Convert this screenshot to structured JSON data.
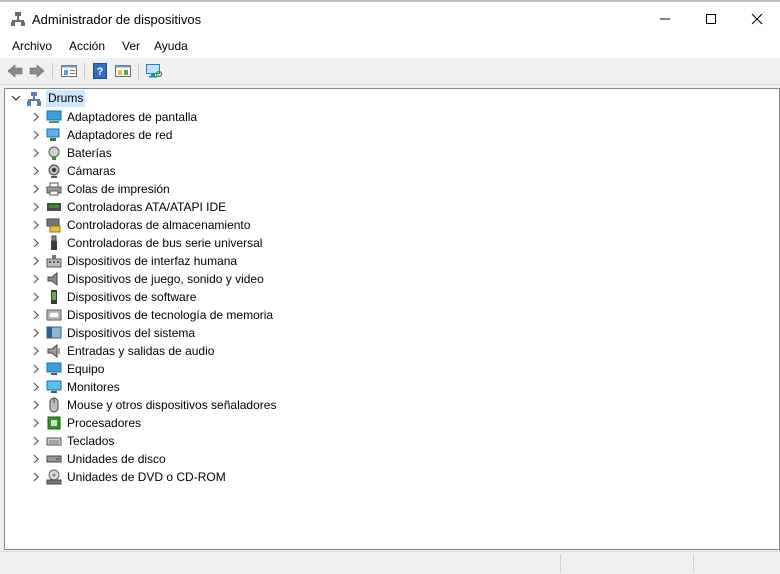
{
  "window": {
    "title": "Administrador de dispositivos"
  },
  "menu": [
    "Archivo",
    "Acción",
    "Ver",
    "Ayuda"
  ],
  "toolbar": [
    "back-icon",
    "forward-icon",
    "properties-icon",
    "help-icon",
    "details-icon",
    "scan-hardware-icon"
  ],
  "tree": {
    "root": {
      "label": "Drums",
      "expanded": true
    },
    "items": [
      {
        "label": "Adaptadores de pantalla",
        "icon": "display-adapter-icon"
      },
      {
        "label": "Adaptadores de red",
        "icon": "network-adapter-icon"
      },
      {
        "label": "Baterías",
        "icon": "battery-icon"
      },
      {
        "label": "Cámaras",
        "icon": "camera-icon"
      },
      {
        "label": "Colas de impresión",
        "icon": "printer-icon"
      },
      {
        "label": "Controladoras ATA/ATAPI IDE",
        "icon": "ide-controller-icon"
      },
      {
        "label": "Controladoras de almacenamiento",
        "icon": "storage-controller-icon"
      },
      {
        "label": "Controladoras de bus serie universal",
        "icon": "usb-icon"
      },
      {
        "label": "Dispositivos de interfaz humana",
        "icon": "hid-icon"
      },
      {
        "label": "Dispositivos de juego, sonido y video",
        "icon": "sound-icon"
      },
      {
        "label": "Dispositivos de software",
        "icon": "software-device-icon"
      },
      {
        "label": "Dispositivos de tecnología de memoria",
        "icon": "memory-device-icon"
      },
      {
        "label": "Dispositivos del sistema",
        "icon": "system-device-icon"
      },
      {
        "label": "Entradas y salidas de audio",
        "icon": "audio-io-icon"
      },
      {
        "label": "Equipo",
        "icon": "computer-icon"
      },
      {
        "label": "Monitores",
        "icon": "monitor-icon"
      },
      {
        "label": "Mouse y otros dispositivos señaladores",
        "icon": "mouse-icon"
      },
      {
        "label": "Procesadores",
        "icon": "processor-icon"
      },
      {
        "label": "Teclados",
        "icon": "keyboard-icon"
      },
      {
        "label": "Unidades de disco",
        "icon": "disk-drive-icon"
      },
      {
        "label": "Unidades de DVD o CD-ROM",
        "icon": "dvd-drive-icon"
      }
    ]
  }
}
